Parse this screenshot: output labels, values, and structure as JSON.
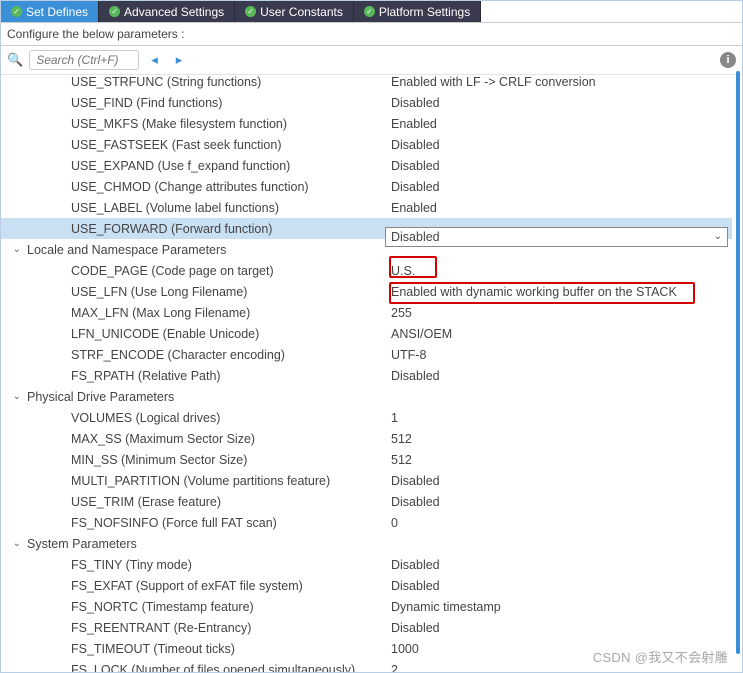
{
  "tabs": [
    {
      "label": "Set Defines",
      "active": true
    },
    {
      "label": "Advanced Settings",
      "active": false
    },
    {
      "label": "User Constants",
      "active": false
    },
    {
      "label": "Platform Settings",
      "active": false
    }
  ],
  "subtitle": "Configure the below parameters :",
  "search": {
    "placeholder": "Search (Ctrl+F)"
  },
  "groups": [
    {
      "name": "",
      "items": [
        {
          "label": "USE_STRFUNC (String functions)",
          "value": "Enabled with LF -> CRLF conversion"
        },
        {
          "label": "USE_FIND (Find functions)",
          "value": "Disabled"
        },
        {
          "label": "USE_MKFS (Make filesystem function)",
          "value": "Enabled"
        },
        {
          "label": "USE_FASTSEEK (Fast seek function)",
          "value": "Disabled"
        },
        {
          "label": "USE_EXPAND (Use f_expand function)",
          "value": "Disabled"
        },
        {
          "label": "USE_CHMOD (Change attributes function)",
          "value": "Disabled"
        },
        {
          "label": "USE_LABEL (Volume label functions)",
          "value": "Enabled"
        },
        {
          "label": "USE_FORWARD (Forward function)",
          "value": "Disabled",
          "selected": true
        }
      ]
    },
    {
      "name": "Locale and Namespace Parameters",
      "items": [
        {
          "label": "CODE_PAGE (Code page on target)",
          "value": "U.S."
        },
        {
          "label": "USE_LFN (Use Long Filename)",
          "value": "Enabled with dynamic working buffer on the STACK"
        },
        {
          "label": "MAX_LFN (Max Long Filename)",
          "value": "255"
        },
        {
          "label": "LFN_UNICODE (Enable Unicode)",
          "value": "ANSI/OEM"
        },
        {
          "label": "STRF_ENCODE (Character encoding)",
          "value": "UTF-8"
        },
        {
          "label": "FS_RPATH (Relative Path)",
          "value": "Disabled"
        }
      ]
    },
    {
      "name": "Physical Drive Parameters",
      "items": [
        {
          "label": "VOLUMES (Logical drives)",
          "value": "1"
        },
        {
          "label": "MAX_SS (Maximum Sector Size)",
          "value": "512"
        },
        {
          "label": "MIN_SS (Minimum Sector Size)",
          "value": "512"
        },
        {
          "label": "MULTI_PARTITION (Volume partitions feature)",
          "value": "Disabled"
        },
        {
          "label": "USE_TRIM (Erase feature)",
          "value": "Disabled"
        },
        {
          "label": "FS_NOFSINFO (Force full FAT scan)",
          "value": "0"
        }
      ]
    },
    {
      "name": "System Parameters",
      "items": [
        {
          "label": "FS_TINY (Tiny mode)",
          "value": "Disabled"
        },
        {
          "label": "FS_EXFAT (Support of exFAT file system)",
          "value": "Disabled"
        },
        {
          "label": "FS_NORTC (Timestamp feature)",
          "value": "Dynamic timestamp"
        },
        {
          "label": "FS_REENTRANT (Re-Entrancy)",
          "value": "Disabled"
        },
        {
          "label": "FS_TIMEOUT (Timeout ticks)",
          "value": "1000"
        },
        {
          "label": "FS_LOCK (Number of files opened simultaneously)",
          "value": "2"
        }
      ]
    }
  ],
  "watermark": "CSDN @我又不会射雕"
}
